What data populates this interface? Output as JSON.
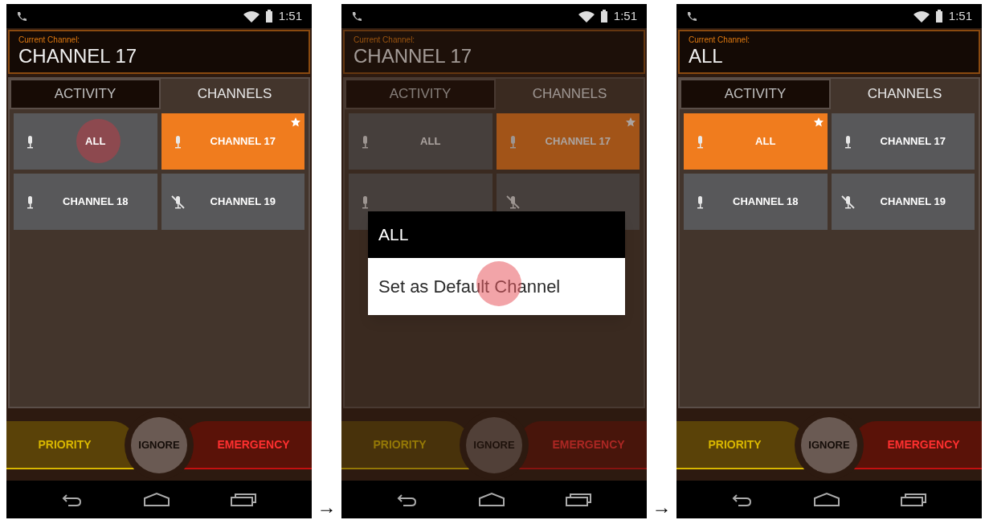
{
  "screens": [
    {
      "status_bar": {
        "time": "1:51"
      },
      "header": {
        "label": "Current Channel:",
        "value": "CHANNEL 17"
      },
      "tabs": [
        {
          "label": "ACTIVITY",
          "selected": false
        },
        {
          "label": "CHANNELS",
          "selected": true
        }
      ],
      "channels": [
        {
          "label": "ALL",
          "muted": false,
          "selected": false,
          "default": false,
          "touched": true
        },
        {
          "label": "CHANNEL 17",
          "muted": false,
          "selected": true,
          "default": true,
          "touched": false
        },
        {
          "label": "CHANNEL 18",
          "muted": false,
          "selected": false,
          "default": false,
          "touched": false
        },
        {
          "label": "CHANNEL 19",
          "muted": true,
          "selected": false,
          "default": false,
          "touched": false
        }
      ],
      "actions": [
        {
          "kind": "priority",
          "label": "PRIORITY"
        },
        {
          "kind": "ignore",
          "label": "IGNORE"
        },
        {
          "kind": "emergency",
          "label": "EMERGENCY"
        }
      ],
      "dimmed": false,
      "arrow": "→"
    },
    {
      "status_bar": {
        "time": "1:51"
      },
      "header": {
        "label": "Current Channel:",
        "value": "CHANNEL 17"
      },
      "tabs": [
        {
          "label": "ACTIVITY",
          "selected": false
        },
        {
          "label": "CHANNELS",
          "selected": true
        }
      ],
      "channels": [
        {
          "label": "ALL",
          "muted": false,
          "selected": false,
          "default": false,
          "touched": false
        },
        {
          "label": "CHANNEL 17",
          "muted": false,
          "selected": true,
          "default": true,
          "touched": false
        },
        {
          "muted": false,
          "selected": false,
          "default": false,
          "touched": false
        },
        {
          "muted": true,
          "selected": false,
          "default": false,
          "touched": false
        }
      ],
      "actions": [
        {
          "kind": "priority",
          "label": "PRIORITY"
        },
        {
          "kind": "ignore",
          "label": "IGNORE"
        },
        {
          "kind": "emergency",
          "label": "EMERGENCY"
        }
      ],
      "dimmed": true,
      "dialog": {
        "title": "ALL",
        "options": [
          {
            "label": "Set as Default Channel",
            "touched": true
          }
        ]
      },
      "arrow": "→"
    },
    {
      "status_bar": {
        "time": "1:51"
      },
      "header": {
        "label": "Current Channel:",
        "value": "ALL"
      },
      "tabs": [
        {
          "label": "ACTIVITY",
          "selected": false
        },
        {
          "label": "CHANNELS",
          "selected": true
        }
      ],
      "channels": [
        {
          "label": "ALL",
          "muted": false,
          "selected": true,
          "default": true,
          "touched": false
        },
        {
          "label": "CHANNEL 17",
          "muted": false,
          "selected": false,
          "default": false,
          "touched": false
        },
        {
          "label": "CHANNEL 18",
          "muted": false,
          "selected": false,
          "default": false,
          "touched": false
        },
        {
          "label": "CHANNEL 19",
          "muted": true,
          "selected": false,
          "default": false,
          "touched": false
        }
      ],
      "actions": [
        {
          "kind": "priority",
          "label": "PRIORITY"
        },
        {
          "kind": "ignore",
          "label": "IGNORE"
        },
        {
          "kind": "emergency",
          "label": "EMERGENCY"
        }
      ],
      "dimmed": false
    }
  ]
}
